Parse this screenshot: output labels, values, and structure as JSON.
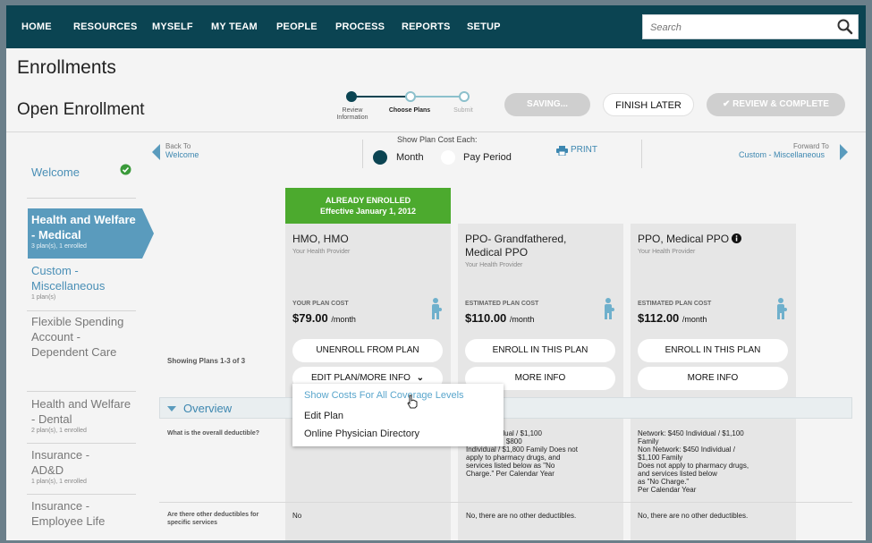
{
  "nav": {
    "items": [
      "HOME",
      "RESOURCES",
      "MYSELF",
      "MY TEAM",
      "PEOPLE",
      "PROCESS",
      "REPORTS",
      "SETUP"
    ],
    "search_placeholder": "Search"
  },
  "header": {
    "title": "Enrollments",
    "subtitle": "Open Enrollment",
    "steps": [
      "Review Information",
      "Choose Plans",
      "Submit"
    ],
    "saving_label": "SAVING...",
    "finish_label": "FINISH LATER",
    "review_label": "✔ REVIEW & COMPLETE"
  },
  "sidebar": {
    "items": [
      {
        "label": "Welcome",
        "sub": ""
      },
      {
        "label": "Health and Welfare - Medical",
        "sub": "3 plan(s), 1 enrolled"
      },
      {
        "label": "Custom - Miscellaneous",
        "sub": "1 plan(s)"
      },
      {
        "label": "Flexible Spending Account - Dependent Care",
        "sub": ""
      },
      {
        "label": "Health and Welfare - Dental",
        "sub": "2 plan(s), 1 enrolled"
      },
      {
        "label": "Insurance - AD&D",
        "sub": "1 plan(s), 1 enrolled"
      },
      {
        "label": "Insurance - Employee Life",
        "sub": ""
      }
    ]
  },
  "plan_nav": {
    "back_to": "Back To",
    "back_target": "Welcome",
    "show_cost_label": "Show Plan Cost Each:",
    "option_month": "Month",
    "option_pay_period": "Pay Period",
    "print_label": "PRINT",
    "forward_to": "Forward To",
    "forward_target": "Custom - Miscellaneous"
  },
  "enrolled_banner": {
    "line1": "ALREADY ENROLLED",
    "line2": "Effective January 1, 2012"
  },
  "showing_label": "Showing Plans 1-3 of 3",
  "plans": [
    {
      "title": "HMO, HMO",
      "provider": "Your Health Provider",
      "cost_label": "YOUR PLAN COST",
      "cost": "$79.00",
      "period": "/month",
      "button1": "UNENROLL FROM PLAN",
      "button2": "EDIT PLAN/MORE INFO"
    },
    {
      "title": "PPO- Grandfathered, Medical PPO",
      "provider": "Your Health Provider",
      "cost_label": "ESTIMATED PLAN COST",
      "cost": "$110.00",
      "period": "/month",
      "button1": "ENROLL IN THIS PLAN",
      "button2": "MORE INFO"
    },
    {
      "title": "PPO, Medical PPO",
      "provider": "Your Health Provider",
      "cost_label": "ESTIMATED PLAN COST",
      "cost": "$112.00",
      "period": "/month",
      "button1": "ENROLL IN THIS PLAN",
      "button2": "MORE INFO"
    }
  ],
  "overview": {
    "label": "Overview",
    "questions": [
      {
        "q": "What is the overall deductible?",
        "answers": [
          "",
          "$450 Individual / $1,100\non Network: $800\nIndividual / $1,800 Family Does not\napply to pharmacy drugs, and\nservices listed below as \"No\nCharge.\" Per Calendar Year",
          "Network: $450 Individual / $1,100\nFamily\nNon Network: $450 Individual /\n$1,100 Family\nDoes not apply to pharmacy drugs,\nand services listed below\nas \"No Charge.\"\nPer Calendar Year"
        ]
      },
      {
        "q": "Are there other deductibles for specific services",
        "answers": [
          "No",
          "No, there are no other deductibles.",
          "No, there are no other deductibles."
        ]
      }
    ]
  },
  "dropdown": {
    "items": [
      "Show Costs For All Coverage Levels",
      "Edit Plan",
      "Online Physician Directory"
    ]
  },
  "colors": {
    "nav_bg": "#0b4452",
    "accent_blue": "#5a9bbd",
    "enrolled_green": "#4caa2e",
    "check_green": "#3a9a3a"
  }
}
